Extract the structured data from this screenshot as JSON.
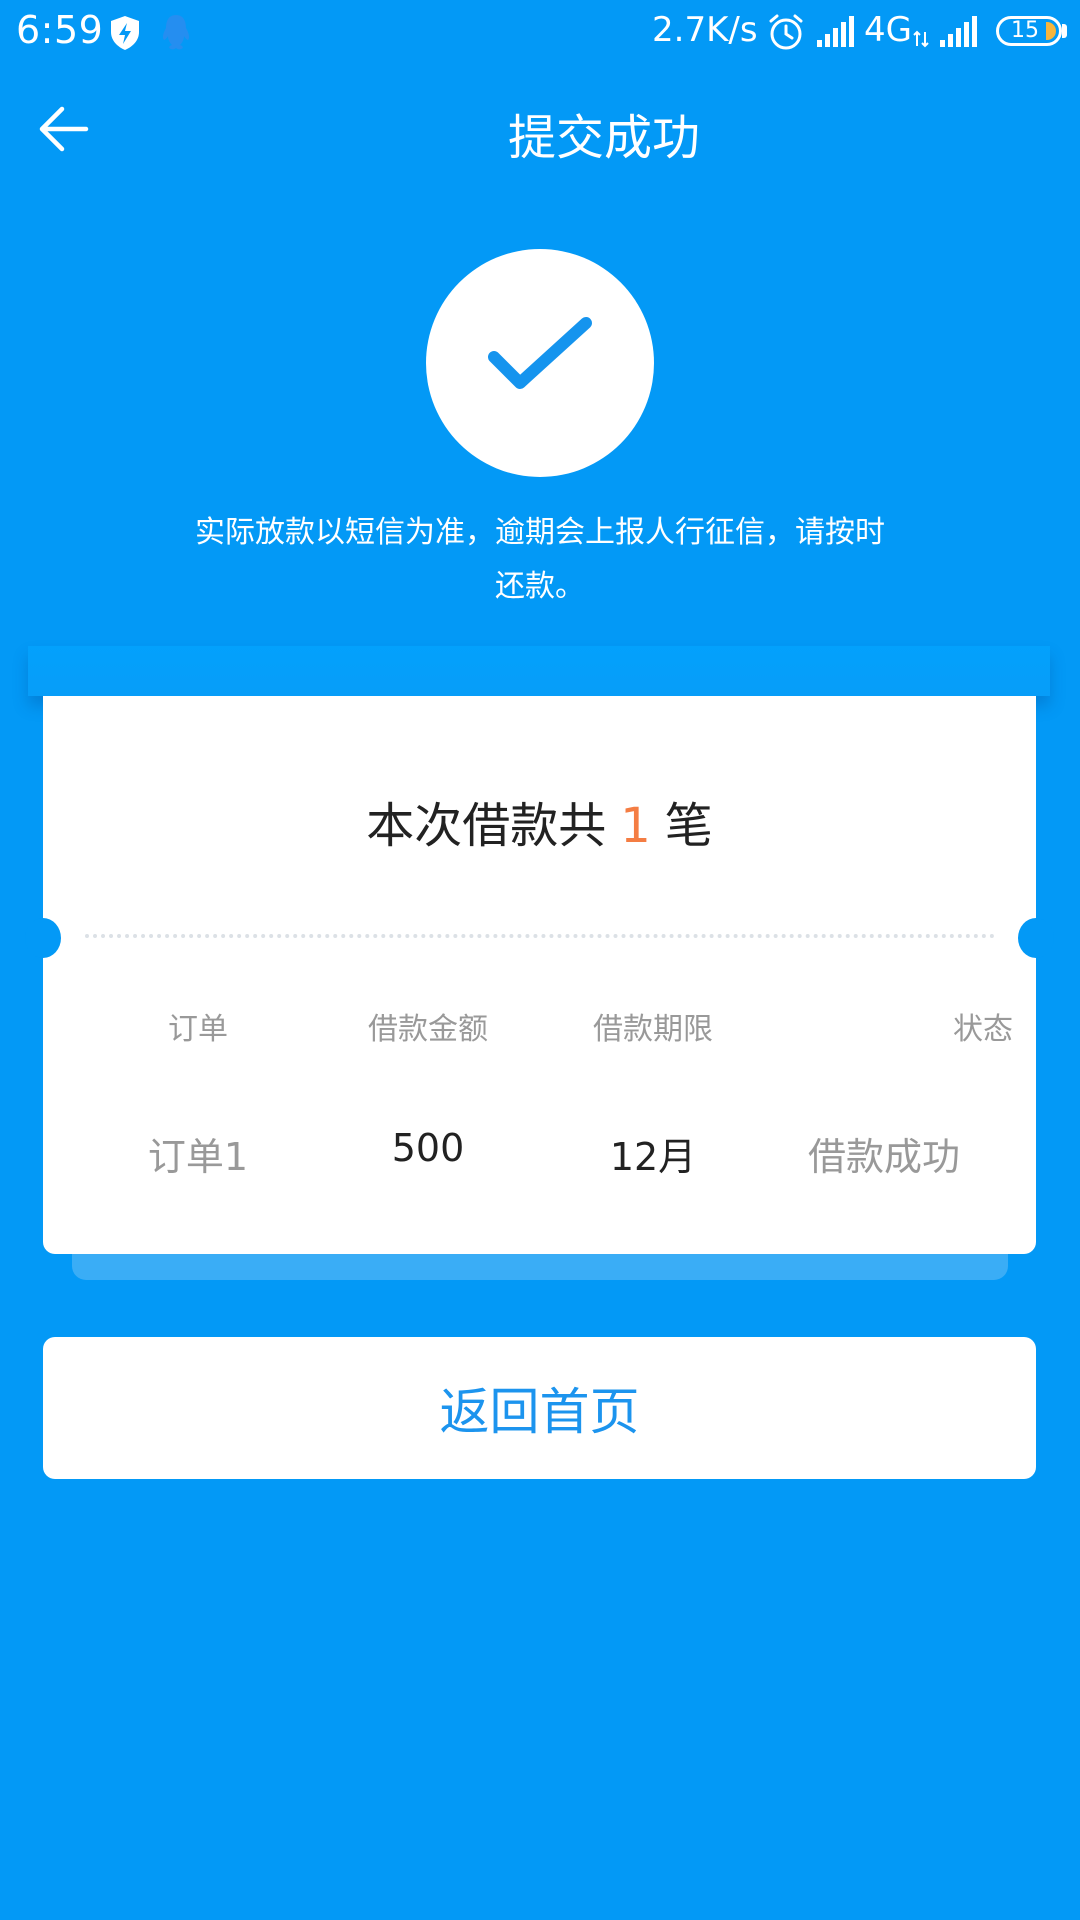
{
  "status_bar": {
    "time": "6:59",
    "net_speed": "2.7K/s",
    "network_type": "4G",
    "battery_level": "15",
    "icons": [
      "shield-icon",
      "qq-icon",
      "alarm-icon",
      "signal-icon",
      "signal-icon",
      "battery-icon"
    ]
  },
  "header": {
    "title": "提交成功",
    "back_icon": "arrow-left-icon"
  },
  "success": {
    "icon": "checkmark-icon",
    "notice_line1": "实际放款以短信为准，逾期会上报人行征信，请按时",
    "notice_line2": "还款。"
  },
  "card": {
    "summary_prefix": "本次借款共",
    "summary_count": "1",
    "summary_suffix": "笔",
    "columns": [
      "订单",
      "借款金额",
      "借款期限",
      "状态"
    ],
    "rows": [
      [
        "订单1",
        "500",
        "12月",
        "借款成功"
      ]
    ]
  },
  "actions": {
    "home_label": "返回首页"
  },
  "colors": {
    "background": "#0399F6",
    "accent_orange": "#F47D43",
    "button_text": "#1C94EE"
  }
}
